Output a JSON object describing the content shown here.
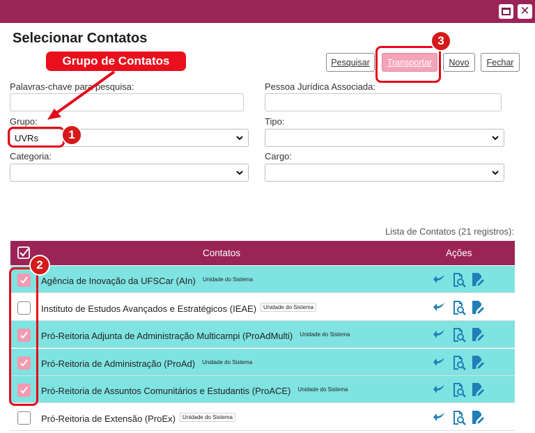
{
  "window": {
    "maximize_icon": "maximize-icon",
    "close_icon": "close-icon"
  },
  "page_title": "Selecionar Contatos",
  "toolbar": {
    "pesquisar": "Pesquisar",
    "transportar": "Transportar",
    "novo": "Novo",
    "fechar": "Fechar"
  },
  "form": {
    "keywords_label": "Palavras-chave para pesquisa:",
    "keywords_value": "",
    "pessoa_label": "Pessoa Jurídica Associada:",
    "pessoa_value": "",
    "grupo_label": "Grupo:",
    "grupo_value": "UVRs",
    "tipo_label": "Tipo:",
    "tipo_value": "",
    "categoria_label": "Categoria:",
    "categoria_value": "",
    "cargo_label": "Cargo:",
    "cargo_value": ""
  },
  "list": {
    "count_text": "Lista de Contatos (21 registros):",
    "header_contatos": "Contatos",
    "header_acoes": "Ações",
    "rows": [
      {
        "name": "Agência de Inovação da UFSCar (AIn)",
        "badge": "Unidade do Sistema",
        "checked": true
      },
      {
        "name": "Instituto de Estudos Avançados e Estratégicos (IEAE)",
        "badge": "Unidade do Sistema",
        "checked": false
      },
      {
        "name": "Pró-Reitoria Adjunta de Administração Multicampi (ProAdMulti)",
        "badge": "Unidade do Sistema",
        "checked": true
      },
      {
        "name": "Pró-Reitoria de Administração (ProAd)",
        "badge": "Unidade do Sistema",
        "checked": true
      },
      {
        "name": "Pró-Reitoria de Assuntos Comunitários e Estudantis (ProACE)",
        "badge": "Unidade do Sistema",
        "checked": true
      },
      {
        "name": "Pró-Reitoria de Extensão (ProEx)",
        "badge": "Unidade do Sistema",
        "checked": false
      }
    ]
  },
  "annotations": {
    "callout": "Grupo de Contatos",
    "num1": "1",
    "num2": "2",
    "num3": "3"
  },
  "colors": {
    "brand": "#9b2456",
    "selected_row": "#7fe3e1",
    "checkbox_on": "#f49ab3",
    "action_icons": "#1f7fb6",
    "annotation": "#e4081b"
  }
}
